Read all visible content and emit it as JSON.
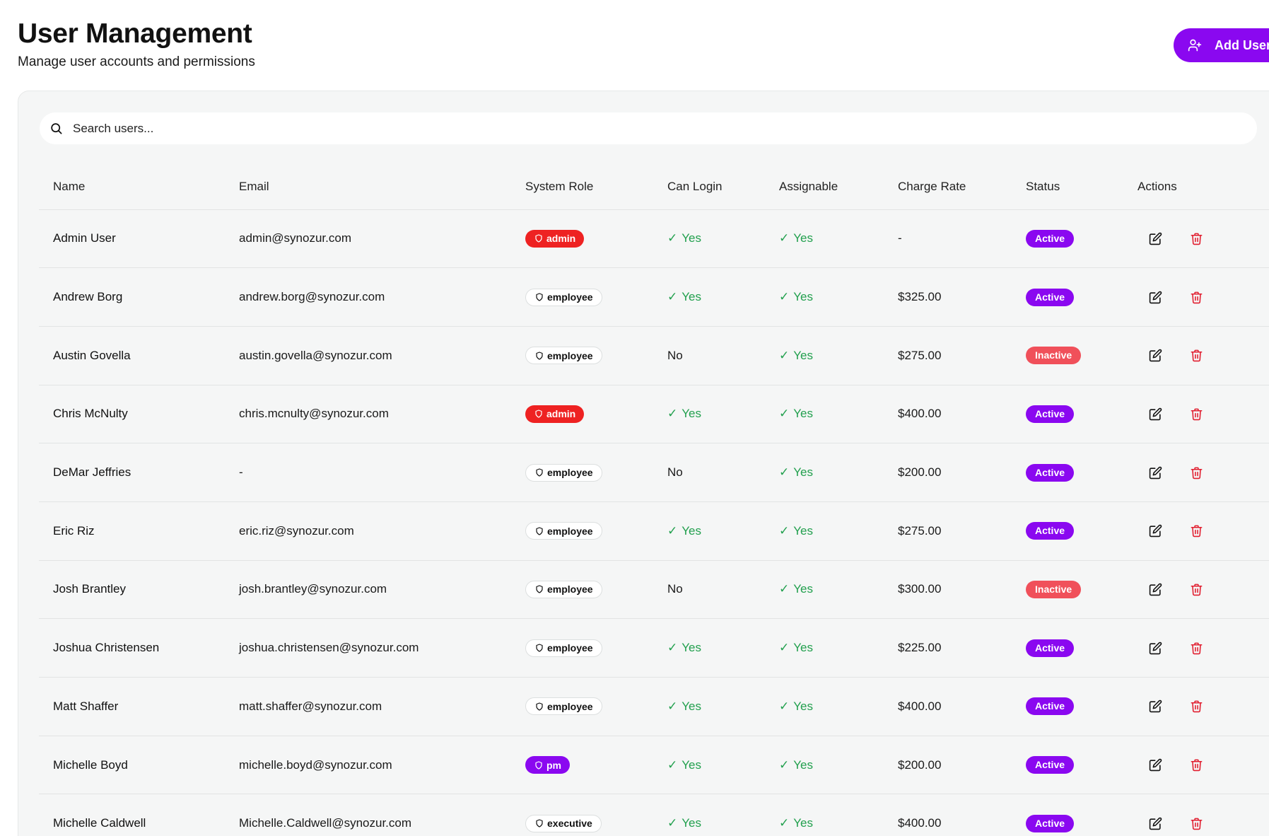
{
  "header": {
    "title": "User Management",
    "subtitle": "Manage user accounts and permissions",
    "add_user_label": "Add User"
  },
  "search": {
    "placeholder": "Search users..."
  },
  "table": {
    "columns": [
      "Name",
      "Email",
      "System Role",
      "Can Login",
      "Assignable",
      "Charge Rate",
      "Status",
      "Actions"
    ],
    "rows": [
      {
        "name": "Admin User",
        "email": "admin@synozur.com",
        "role": "admin",
        "can_login": "Yes",
        "assignable": "Yes",
        "charge_rate": "-",
        "status": "Active"
      },
      {
        "name": "Andrew Borg",
        "email": "andrew.borg@synozur.com",
        "role": "employee",
        "can_login": "Yes",
        "assignable": "Yes",
        "charge_rate": "$325.00",
        "status": "Active"
      },
      {
        "name": "Austin Govella",
        "email": "austin.govella@synozur.com",
        "role": "employee",
        "can_login": "No",
        "assignable": "Yes",
        "charge_rate": "$275.00",
        "status": "Inactive"
      },
      {
        "name": "Chris McNulty",
        "email": "chris.mcnulty@synozur.com",
        "role": "admin",
        "can_login": "Yes",
        "assignable": "Yes",
        "charge_rate": "$400.00",
        "status": "Active"
      },
      {
        "name": "DeMar Jeffries",
        "email": "-",
        "role": "employee",
        "can_login": "No",
        "assignable": "Yes",
        "charge_rate": "$200.00",
        "status": "Active"
      },
      {
        "name": "Eric Riz",
        "email": "eric.riz@synozur.com",
        "role": "employee",
        "can_login": "Yes",
        "assignable": "Yes",
        "charge_rate": "$275.00",
        "status": "Active"
      },
      {
        "name": "Josh Brantley",
        "email": "josh.brantley@synozur.com",
        "role": "employee",
        "can_login": "No",
        "assignable": "Yes",
        "charge_rate": "$300.00",
        "status": "Inactive"
      },
      {
        "name": "Joshua Christensen",
        "email": "joshua.christensen@synozur.com",
        "role": "employee",
        "can_login": "Yes",
        "assignable": "Yes",
        "charge_rate": "$225.00",
        "status": "Active"
      },
      {
        "name": "Matt Shaffer",
        "email": "matt.shaffer@synozur.com",
        "role": "employee",
        "can_login": "Yes",
        "assignable": "Yes",
        "charge_rate": "$400.00",
        "status": "Active"
      },
      {
        "name": "Michelle Boyd",
        "email": "michelle.boyd@synozur.com",
        "role": "pm",
        "can_login": "Yes",
        "assignable": "Yes",
        "charge_rate": "$200.00",
        "status": "Active"
      },
      {
        "name": "Michelle Caldwell",
        "email": "Michelle.Caldwell@synozur.com",
        "role": "executive",
        "can_login": "Yes",
        "assignable": "Yes",
        "charge_rate": "$400.00",
        "status": "Active"
      }
    ]
  },
  "icons": {
    "add_user": "user-plus-icon",
    "search": "search-icon",
    "role": "shield-icon",
    "edit": "edit-icon",
    "delete": "trash-icon"
  },
  "colors": {
    "accent": "#8a08f0",
    "admin_badge": "#ee2222",
    "inactive_badge": "#f0505a",
    "yes_text": "#22a04e",
    "delete_icon": "#e11d2e"
  }
}
